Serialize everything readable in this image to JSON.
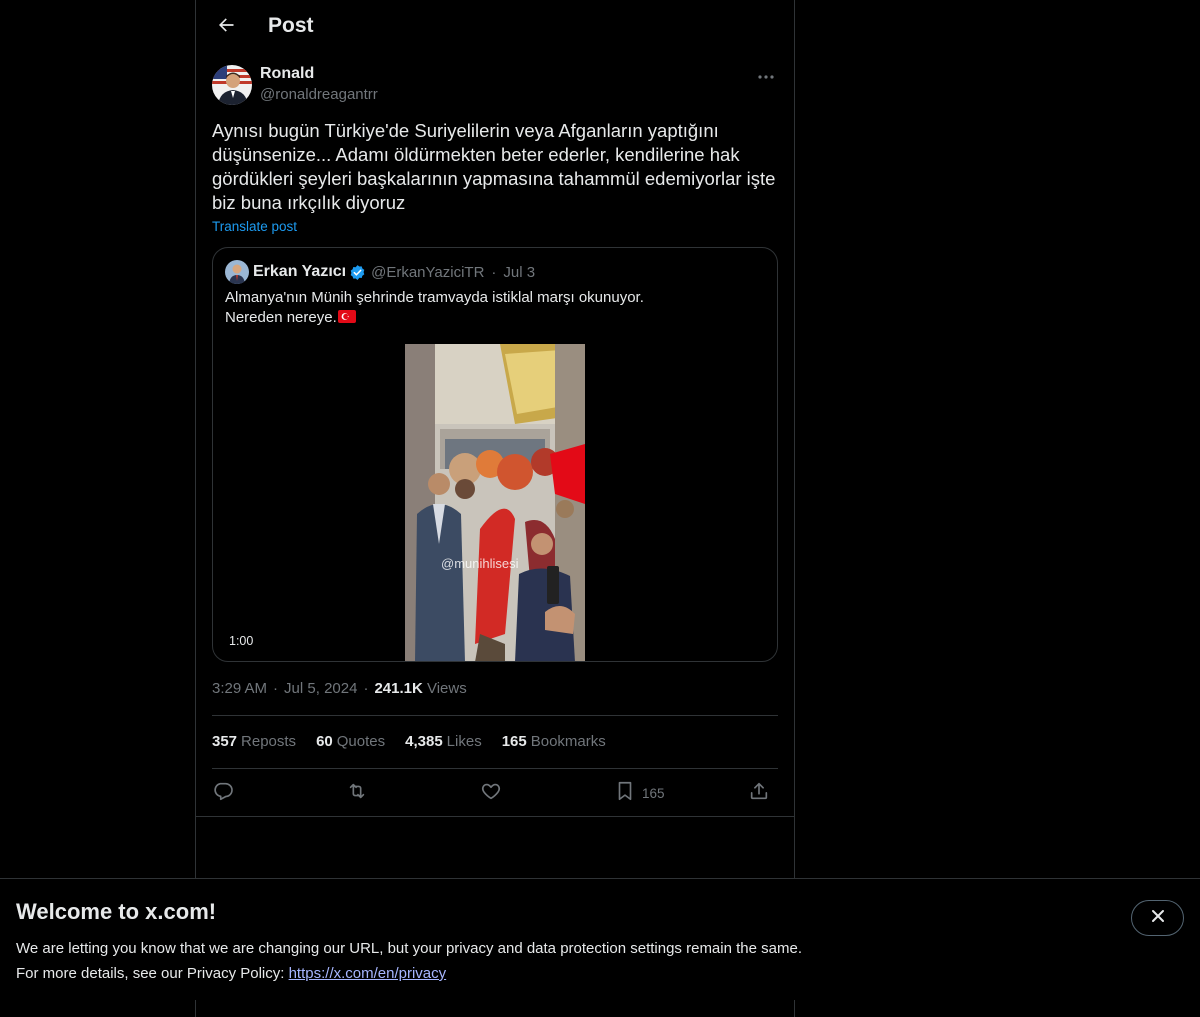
{
  "header": {
    "title": "Post",
    "back_icon": "arrow-left-icon"
  },
  "author": {
    "name": "Ronald",
    "handle": "@ronaldreagantrr"
  },
  "post": {
    "text": "Aynısı bugün Türkiye'de Suriyelilerin veya Afganların yaptığını düşünsenize... Adamı öldürmekten beter ederler, kendilerine hak gördükleri şeyleri başkalarının yapmasına tahammül edemiyorlar işte biz buna ırkçılık diyoruz",
    "translate_label": "Translate post",
    "time": "3:29 AM",
    "date": "Jul 5, 2024",
    "views_count": "241.1K",
    "views_label": "Views"
  },
  "quote": {
    "name": "Erkan Yazıcı",
    "handle": "@ErkanYaziciTR",
    "date": "Jul 3",
    "line1": "Almanya'nın Münih şehrinde tramvayda istiklal marşı okunuyor.",
    "line2": "Nereden nereye.",
    "video_watermark": "@munihlisesi",
    "video_duration": "1:00"
  },
  "stats": {
    "reposts_count": "357",
    "reposts_label": "Reposts",
    "quotes_count": "60",
    "quotes_label": "Quotes",
    "likes_count": "4,385",
    "likes_label": "Likes",
    "bookmarks_count": "165",
    "bookmarks_label": "Bookmarks"
  },
  "actions": {
    "reply_icon": "reply-icon",
    "repost_icon": "repost-icon",
    "like_icon": "heart-icon",
    "bookmark_icon": "bookmark-icon",
    "bookmark_count": "165",
    "share_icon": "share-icon"
  },
  "banner": {
    "title": "Welcome to x.com!",
    "line1": "We are letting you know that we are changing our URL, but your privacy and data protection settings remain the same.",
    "line2_prefix": "For more details, see our Privacy Policy: ",
    "link": "https://x.com/en/privacy"
  },
  "colors": {
    "accent": "#1d9bf0",
    "text": "#e7e9ea",
    "muted": "#71767b",
    "border": "#2f3336",
    "background": "#000000"
  }
}
